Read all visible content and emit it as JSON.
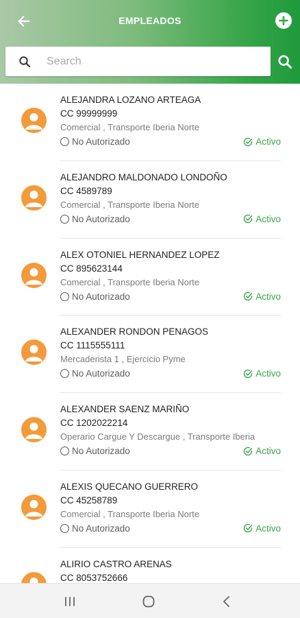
{
  "header": {
    "title": "EMPLEADOS",
    "back_icon": "arrow-left-icon",
    "add_icon": "plus-circle-icon"
  },
  "search": {
    "placeholder": "Search",
    "value": "",
    "icon": "search-icon"
  },
  "employees": [
    {
      "name": "ALEJANDRA LOZANO ARTEAGA",
      "cc": "CC 99999999",
      "role": "Comercial , Transporte Iberia Norte",
      "authorization": "No Autorizado",
      "status": "Activo"
    },
    {
      "name": "ALEJANDRO MALDONADO LONDOÑO",
      "cc": "CC 4589789",
      "role": "Comercial , Transporte Iberia Norte",
      "authorization": "No Autorizado",
      "status": "Activo"
    },
    {
      "name": "ALEX OTONIEL HERNANDEZ LOPEZ",
      "cc": "CC 895623144",
      "role": "Comercial , Transporte Iberia Norte",
      "authorization": "No Autorizado",
      "status": "Activo"
    },
    {
      "name": "ALEXANDER RONDON PENAGOS",
      "cc": "CC 1115555111",
      "role": "Mercaderista 1 , Ejercicio Pyme",
      "authorization": "No Autorizado",
      "status": "Activo"
    },
    {
      "name": "ALEXANDER SAENZ MARIÑO",
      "cc": "CC 1202022214",
      "role": "Operario Cargue Y Descargue , Transporte Iberia",
      "authorization": "No Autorizado",
      "status": "Activo"
    },
    {
      "name": "ALEXIS QUECANO GUERRERO",
      "cc": "CC 45258789",
      "role": "Comercial , Transporte Iberia Norte",
      "authorization": "No Autorizado",
      "status": "Activo"
    },
    {
      "name": "ALIRIO CASTRO ARENAS",
      "cc": "CC 8053752666",
      "role": "",
      "authorization": "",
      "status": ""
    }
  ],
  "colors": {
    "accent_green": "#3aa64b",
    "avatar_orange": "#f39a3b"
  },
  "navbar": {
    "recents_icon": "recent-apps-icon",
    "home_icon": "home-circle-icon",
    "back_icon": "chevron-left-icon"
  }
}
